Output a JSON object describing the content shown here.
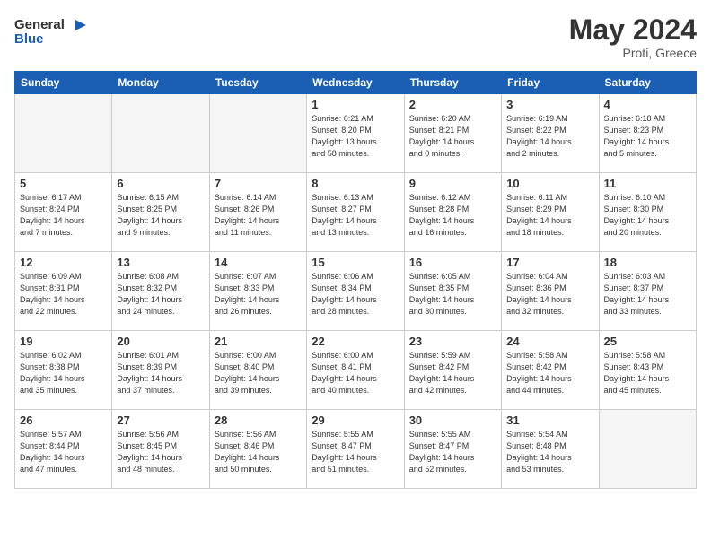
{
  "logo": {
    "line1": "General",
    "line2": "Blue"
  },
  "title": "May 2024",
  "location": "Proti, Greece",
  "days_header": [
    "Sunday",
    "Monday",
    "Tuesday",
    "Wednesday",
    "Thursday",
    "Friday",
    "Saturday"
  ],
  "weeks": [
    [
      {
        "day": "",
        "info": ""
      },
      {
        "day": "",
        "info": ""
      },
      {
        "day": "",
        "info": ""
      },
      {
        "day": "1",
        "info": "Sunrise: 6:21 AM\nSunset: 8:20 PM\nDaylight: 13 hours\nand 58 minutes."
      },
      {
        "day": "2",
        "info": "Sunrise: 6:20 AM\nSunset: 8:21 PM\nDaylight: 14 hours\nand 0 minutes."
      },
      {
        "day": "3",
        "info": "Sunrise: 6:19 AM\nSunset: 8:22 PM\nDaylight: 14 hours\nand 2 minutes."
      },
      {
        "day": "4",
        "info": "Sunrise: 6:18 AM\nSunset: 8:23 PM\nDaylight: 14 hours\nand 5 minutes."
      }
    ],
    [
      {
        "day": "5",
        "info": "Sunrise: 6:17 AM\nSunset: 8:24 PM\nDaylight: 14 hours\nand 7 minutes."
      },
      {
        "day": "6",
        "info": "Sunrise: 6:15 AM\nSunset: 8:25 PM\nDaylight: 14 hours\nand 9 minutes."
      },
      {
        "day": "7",
        "info": "Sunrise: 6:14 AM\nSunset: 8:26 PM\nDaylight: 14 hours\nand 11 minutes."
      },
      {
        "day": "8",
        "info": "Sunrise: 6:13 AM\nSunset: 8:27 PM\nDaylight: 14 hours\nand 13 minutes."
      },
      {
        "day": "9",
        "info": "Sunrise: 6:12 AM\nSunset: 8:28 PM\nDaylight: 14 hours\nand 16 minutes."
      },
      {
        "day": "10",
        "info": "Sunrise: 6:11 AM\nSunset: 8:29 PM\nDaylight: 14 hours\nand 18 minutes."
      },
      {
        "day": "11",
        "info": "Sunrise: 6:10 AM\nSunset: 8:30 PM\nDaylight: 14 hours\nand 20 minutes."
      }
    ],
    [
      {
        "day": "12",
        "info": "Sunrise: 6:09 AM\nSunset: 8:31 PM\nDaylight: 14 hours\nand 22 minutes."
      },
      {
        "day": "13",
        "info": "Sunrise: 6:08 AM\nSunset: 8:32 PM\nDaylight: 14 hours\nand 24 minutes."
      },
      {
        "day": "14",
        "info": "Sunrise: 6:07 AM\nSunset: 8:33 PM\nDaylight: 14 hours\nand 26 minutes."
      },
      {
        "day": "15",
        "info": "Sunrise: 6:06 AM\nSunset: 8:34 PM\nDaylight: 14 hours\nand 28 minutes."
      },
      {
        "day": "16",
        "info": "Sunrise: 6:05 AM\nSunset: 8:35 PM\nDaylight: 14 hours\nand 30 minutes."
      },
      {
        "day": "17",
        "info": "Sunrise: 6:04 AM\nSunset: 8:36 PM\nDaylight: 14 hours\nand 32 minutes."
      },
      {
        "day": "18",
        "info": "Sunrise: 6:03 AM\nSunset: 8:37 PM\nDaylight: 14 hours\nand 33 minutes."
      }
    ],
    [
      {
        "day": "19",
        "info": "Sunrise: 6:02 AM\nSunset: 8:38 PM\nDaylight: 14 hours\nand 35 minutes."
      },
      {
        "day": "20",
        "info": "Sunrise: 6:01 AM\nSunset: 8:39 PM\nDaylight: 14 hours\nand 37 minutes."
      },
      {
        "day": "21",
        "info": "Sunrise: 6:00 AM\nSunset: 8:40 PM\nDaylight: 14 hours\nand 39 minutes."
      },
      {
        "day": "22",
        "info": "Sunrise: 6:00 AM\nSunset: 8:41 PM\nDaylight: 14 hours\nand 40 minutes."
      },
      {
        "day": "23",
        "info": "Sunrise: 5:59 AM\nSunset: 8:42 PM\nDaylight: 14 hours\nand 42 minutes."
      },
      {
        "day": "24",
        "info": "Sunrise: 5:58 AM\nSunset: 8:42 PM\nDaylight: 14 hours\nand 44 minutes."
      },
      {
        "day": "25",
        "info": "Sunrise: 5:58 AM\nSunset: 8:43 PM\nDaylight: 14 hours\nand 45 minutes."
      }
    ],
    [
      {
        "day": "26",
        "info": "Sunrise: 5:57 AM\nSunset: 8:44 PM\nDaylight: 14 hours\nand 47 minutes."
      },
      {
        "day": "27",
        "info": "Sunrise: 5:56 AM\nSunset: 8:45 PM\nDaylight: 14 hours\nand 48 minutes."
      },
      {
        "day": "28",
        "info": "Sunrise: 5:56 AM\nSunset: 8:46 PM\nDaylight: 14 hours\nand 50 minutes."
      },
      {
        "day": "29",
        "info": "Sunrise: 5:55 AM\nSunset: 8:47 PM\nDaylight: 14 hours\nand 51 minutes."
      },
      {
        "day": "30",
        "info": "Sunrise: 5:55 AM\nSunset: 8:47 PM\nDaylight: 14 hours\nand 52 minutes."
      },
      {
        "day": "31",
        "info": "Sunrise: 5:54 AM\nSunset: 8:48 PM\nDaylight: 14 hours\nand 53 minutes."
      },
      {
        "day": "",
        "info": ""
      }
    ]
  ]
}
